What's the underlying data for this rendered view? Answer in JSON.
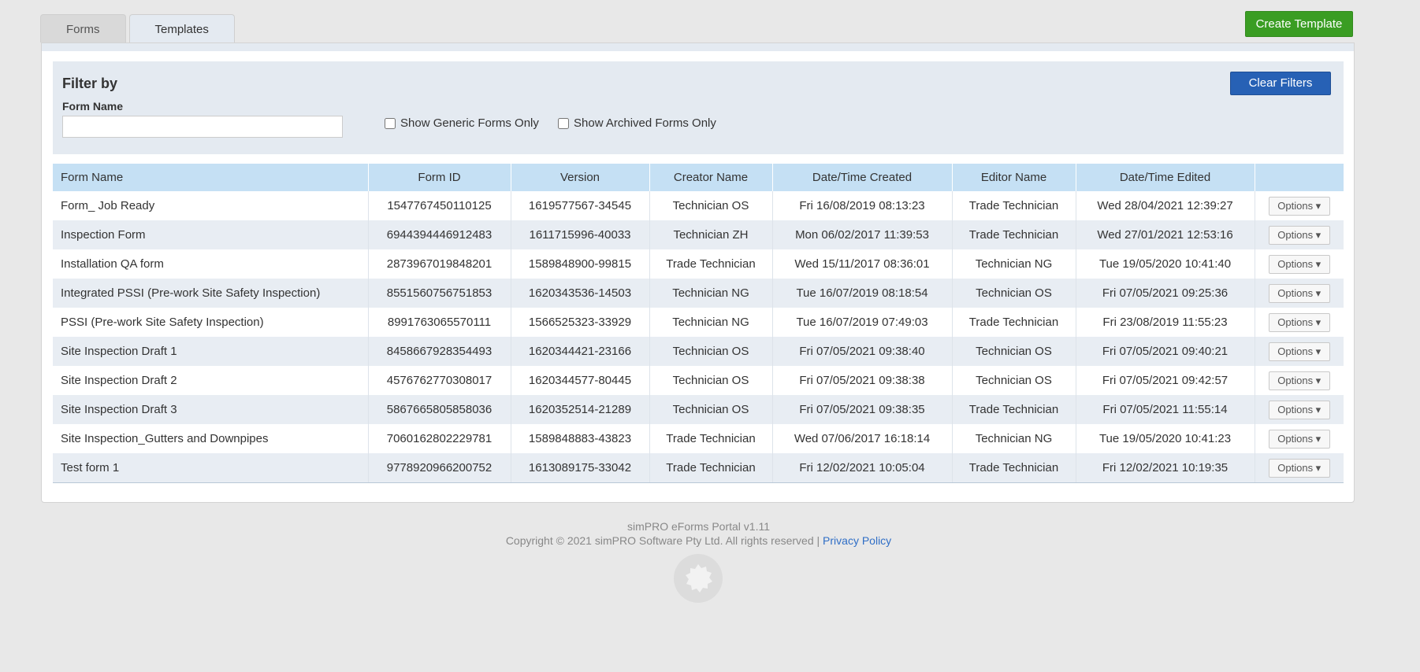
{
  "tabs": [
    {
      "label": "Forms",
      "active": false
    },
    {
      "label": "Templates",
      "active": true
    }
  ],
  "create_button": "Create Template",
  "filter": {
    "title": "Filter by",
    "form_name_label": "Form Name",
    "form_name_value": "",
    "generic_only": "Show Generic Forms Only",
    "archived_only": "Show Archived Forms Only",
    "clear_button": "Clear Filters"
  },
  "table": {
    "headers": [
      "Form Name",
      "Form ID",
      "Version",
      "Creator Name",
      "Date/Time Created",
      "Editor Name",
      "Date/Time Edited",
      ""
    ],
    "options_label": "Options ▾",
    "rows": [
      [
        "Form_ Job Ready",
        "1547767450110125",
        "1619577567-34545",
        "Technician OS",
        "Fri 16/08/2019 08:13:23",
        "Trade Technician",
        "Wed 28/04/2021 12:39:27"
      ],
      [
        "Inspection Form",
        "6944394446912483",
        "1611715996-40033",
        "Technician ZH",
        "Mon 06/02/2017 11:39:53",
        "Trade Technician",
        "Wed 27/01/2021 12:53:16"
      ],
      [
        "Installation QA form",
        "2873967019848201",
        "1589848900-99815",
        "Trade Technician",
        "Wed 15/11/2017 08:36:01",
        "Technician NG",
        "Tue 19/05/2020 10:41:40"
      ],
      [
        "Integrated PSSI (Pre-work Site Safety Inspection)",
        "8551560756751853",
        "1620343536-14503",
        "Technician NG",
        "Tue 16/07/2019 08:18:54",
        "Technician OS",
        "Fri 07/05/2021 09:25:36"
      ],
      [
        "PSSI (Pre-work Site Safety Inspection)",
        "8991763065570111",
        "1566525323-33929",
        "Technician NG",
        "Tue 16/07/2019 07:49:03",
        "Trade Technician",
        "Fri 23/08/2019 11:55:23"
      ],
      [
        "Site Inspection Draft 1",
        "8458667928354493",
        "1620344421-23166",
        "Technician OS",
        "Fri 07/05/2021 09:38:40",
        "Technician OS",
        "Fri 07/05/2021 09:40:21"
      ],
      [
        "Site Inspection Draft 2",
        "4576762770308017",
        "1620344577-80445",
        "Technician OS",
        "Fri 07/05/2021 09:38:38",
        "Technician OS",
        "Fri 07/05/2021 09:42:57"
      ],
      [
        "Site Inspection Draft 3",
        "5867665805858036",
        "1620352514-21289",
        "Technician OS",
        "Fri 07/05/2021 09:38:35",
        "Trade Technician",
        "Fri 07/05/2021 11:55:14"
      ],
      [
        "Site Inspection_Gutters and Downpipes",
        "7060162802229781",
        "1589848883-43823",
        "Trade Technician",
        "Wed 07/06/2017 16:18:14",
        "Technician NG",
        "Tue 19/05/2020 10:41:23"
      ],
      [
        "Test form 1",
        "9778920966200752",
        "1613089175-33042",
        "Trade Technician",
        "Fri 12/02/2021 10:05:04",
        "Trade Technician",
        "Fri 12/02/2021 10:19:35"
      ]
    ]
  },
  "footer": {
    "version": "simPRO eForms Portal v1.11",
    "copyright": "Copyright © 2021 simPRO Software Pty Ltd. All rights reserved |",
    "privacy_link": "Privacy Policy"
  },
  "icons": {
    "logo": "gear-logo-icon",
    "dropdown": "caret-down-icon"
  },
  "colors": {
    "create": "#3a9d23",
    "clear": "#2761b5",
    "header": "#c5e0f4"
  }
}
